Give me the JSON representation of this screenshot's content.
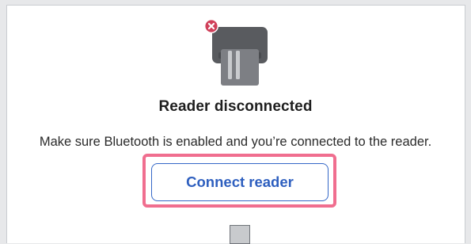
{
  "status": {
    "title": "Reader disconnected",
    "message": "Make sure Bluetooth is enabled and you’re connected to the reader."
  },
  "actions": {
    "connect_label": "Connect reader"
  },
  "icons": {
    "reader": "card-reader-icon",
    "error": "error-x-badge-icon"
  },
  "colors": {
    "accent": "#2e5fbf",
    "error_badge": "#d0405a",
    "highlight": "#f06e8f"
  }
}
